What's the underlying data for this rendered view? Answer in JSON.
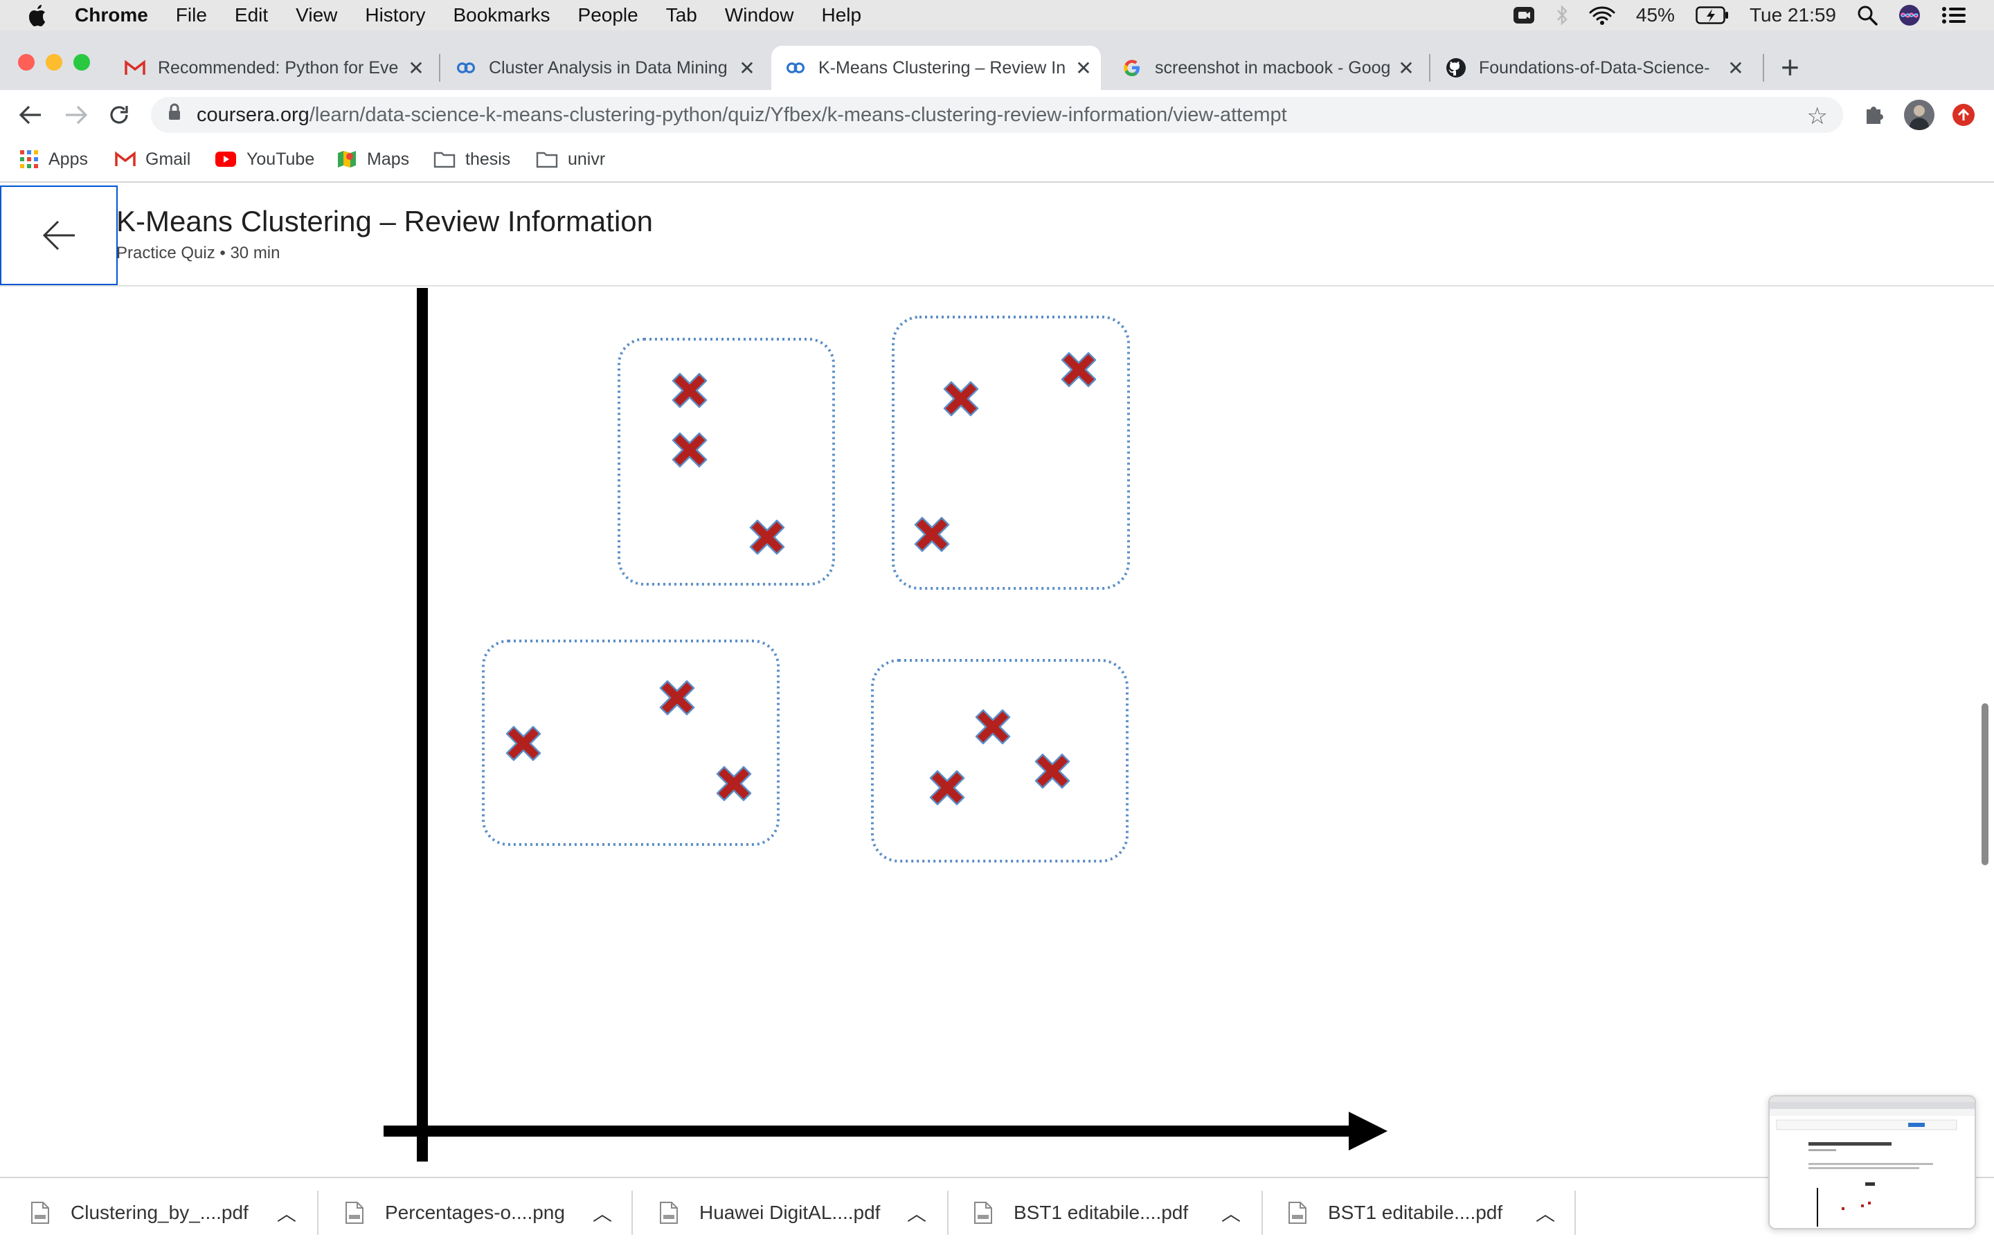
{
  "menubar": {
    "app": "Chrome",
    "items": [
      "File",
      "Edit",
      "View",
      "History",
      "Bookmarks",
      "People",
      "Tab",
      "Window",
      "Help"
    ],
    "battery": "45%",
    "clock": "Tue 21:59"
  },
  "tabs": [
    {
      "title": "Recommended: Python for Eve",
      "icon": "gmail-icon"
    },
    {
      "title": "Cluster Analysis in Data Mining",
      "icon": "coursera-icon"
    },
    {
      "title": "K-Means Clustering – Review In",
      "icon": "coursera-icon",
      "active": true
    },
    {
      "title": "screenshot in macbook - Goog",
      "icon": "google-icon"
    },
    {
      "title": "Foundations-of-Data-Science-",
      "icon": "github-icon"
    }
  ],
  "address": {
    "domain": "coursera.org",
    "path": "/learn/data-science-k-means-clustering-python/quiz/Yfbex/k-means-clustering-review-information/view-attempt"
  },
  "bookmarks": [
    "Apps",
    "Gmail",
    "YouTube",
    "Maps",
    "thesis",
    "univr"
  ],
  "page": {
    "title": "K-Means Clustering – Review Information",
    "subtitle": "Practice Quiz • 30 min"
  },
  "figure": {
    "cluster_count": 4,
    "points_per_cluster": [
      3,
      3,
      3,
      3
    ],
    "marker": "x-mark",
    "marker_color": "#b3211e",
    "cluster_outline_color": "#5b8ec7",
    "axis_color": "#000000"
  },
  "downloads": [
    "Clustering_by_....pdf",
    "Percentages-o....png",
    "Huawei DigitAL....pdf",
    "BST1 editabile....pdf",
    "BST1 editabile....pdf"
  ]
}
